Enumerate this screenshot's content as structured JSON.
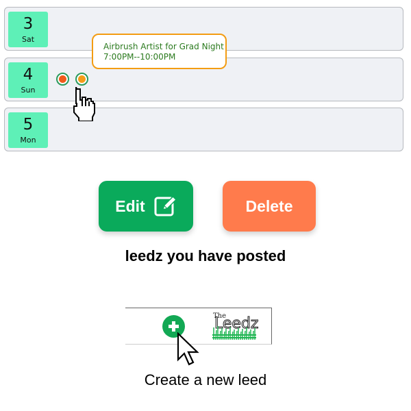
{
  "calendar": {
    "days": [
      {
        "num": "3",
        "name": "Sat"
      },
      {
        "num": "4",
        "name": "Sun"
      },
      {
        "num": "5",
        "name": "Mon"
      }
    ],
    "event_dots": [
      {
        "color": "#f15a1b"
      },
      {
        "color": "#f59c1a"
      }
    ],
    "tooltip": {
      "title": "Airbrush Artist for Grad Night",
      "time": "7:00PM--10:00PM"
    }
  },
  "actions": {
    "edit_label": "Edit",
    "delete_label": "Delete",
    "posted_caption": "leedz you have posted"
  },
  "create": {
    "logo_the": "The",
    "logo_word": "Leedz",
    "caption": "Create a new leed"
  },
  "colors": {
    "badge": "#5ef0b7",
    "edit": "#0aaa5b",
    "delete": "#ff7b4c",
    "tooltip_border": "#f39c12"
  }
}
